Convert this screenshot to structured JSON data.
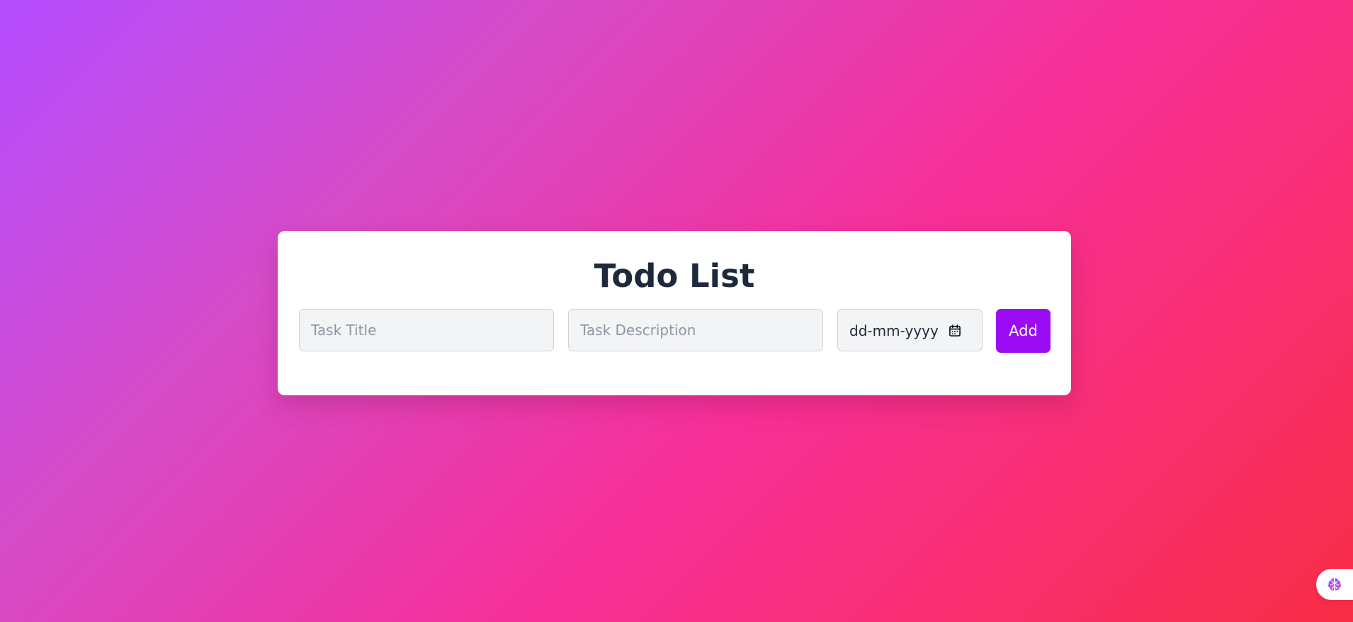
{
  "app": {
    "title": "Todo List"
  },
  "form": {
    "title_placeholder": "Task Title",
    "description_placeholder": "Task Description",
    "date_placeholder": "dd-mm-yyyy",
    "add_label": "Add"
  },
  "icons": {
    "date_picker": "calendar-icon",
    "assistant": "brain-icon"
  },
  "colors": {
    "gradient_start": "#b44cff",
    "gradient_middle": "#f72f98",
    "gradient_end": "#f92d45",
    "accent": "#9b0bf3",
    "text": "#1e293b"
  }
}
